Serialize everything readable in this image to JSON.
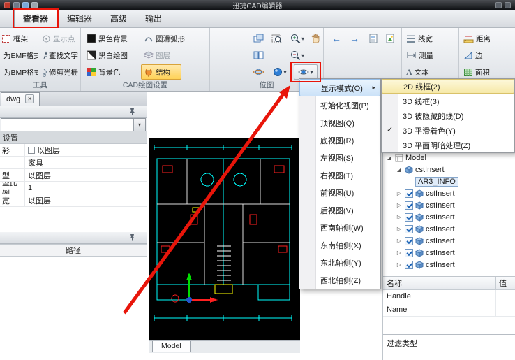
{
  "titlebar": {
    "title": "迅捷CAD编辑器"
  },
  "menubar": {
    "tabs": [
      {
        "label": "查看器"
      },
      {
        "label": "编辑器"
      },
      {
        "label": "高级"
      },
      {
        "label": "输出"
      }
    ]
  },
  "ribbon": {
    "tools": {
      "label": "工具",
      "frame": "框架",
      "emf": "为EMF格式",
      "bmp": "为BMP格式",
      "show_point": "显示点",
      "find_text": "查找文字",
      "trim_raster": "修剪光栅"
    },
    "cad": {
      "label": "CAD绘图设置",
      "black_bg": "黑色背景",
      "bw": "黑白绘图",
      "bg_color": "背景色",
      "smooth": "圆滑弧形",
      "layers": "图层",
      "structure": "结构"
    },
    "view": {
      "label": "位图"
    },
    "measure": {
      "line_width": "线宽",
      "measure": "测量",
      "text": "文本",
      "distance": "距离",
      "edge": "边",
      "area": "面积"
    }
  },
  "doc_tab": {
    "label": "dwg"
  },
  "left": {
    "category": "设置",
    "rows": [
      {
        "label": "彩",
        "value": "以图层"
      },
      {
        "label": "",
        "value": "家具"
      },
      {
        "label": "型",
        "value": "以图层"
      },
      {
        "label": "型比例",
        "value": "1"
      },
      {
        "label": "宽",
        "value": "以图层"
      }
    ],
    "path_header": "路径"
  },
  "canvas": {
    "layout_tab": "Model"
  },
  "menu": {
    "items": [
      {
        "label": "显示模式(O)"
      },
      {
        "label": "初始化视图(P)"
      },
      {
        "label": "顶视图(Q)"
      },
      {
        "label": "底视图(R)"
      },
      {
        "label": "左视图(S)"
      },
      {
        "label": "右视图(T)"
      },
      {
        "label": "前视图(U)"
      },
      {
        "label": "后视图(V)"
      },
      {
        "label": "西南轴侧(W)"
      },
      {
        "label": "东南轴侧(X)"
      },
      {
        "label": "东北轴侧(Y)"
      },
      {
        "label": "西北轴侧(Z)"
      }
    ]
  },
  "submenu": {
    "items": [
      {
        "label": "2D 线框(2)"
      },
      {
        "label": "3D 线框(3)"
      },
      {
        "label": "3D 被隐藏的线(D)"
      },
      {
        "label": "3D 平滑着色(Y)"
      },
      {
        "label": "3D 平面阴暗处理(Z)"
      }
    ]
  },
  "tree": {
    "root": "Model",
    "block": "cstInsert",
    "selected": "AR3_INFO",
    "items": [
      "cstInsert",
      "cstInsert",
      "cstInsert",
      "cstInsert",
      "cstInsert",
      "cstInsert",
      "cstInsert"
    ]
  },
  "detail": {
    "name_header": "名称",
    "value_header": "值",
    "rows": [
      {
        "label": "Handle",
        "value": ""
      },
      {
        "label": "Name",
        "value": ""
      }
    ],
    "filter": "过滤类型"
  },
  "icons": {
    "dropdown": "▾",
    "combo": "▾",
    "submenu_arrow": "▸",
    "check": "✓",
    "close": "✕",
    "back": "←",
    "forward": "→",
    "text": "A",
    "expand_open": "◢",
    "expand_closed": "▷"
  },
  "colors": {
    "annotation": "#e8150a",
    "structure_active": "#ffd257",
    "canvas_bg": "#000000",
    "cad_line": "#00ffff"
  }
}
